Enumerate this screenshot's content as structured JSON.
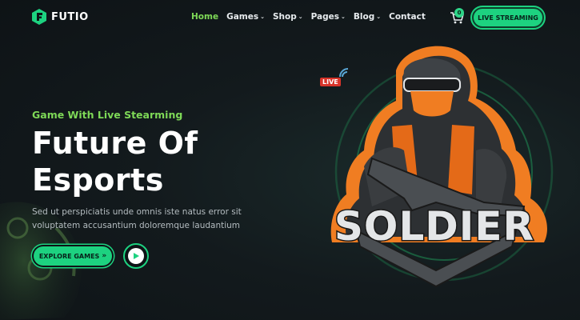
{
  "header": {
    "logo_text": "FUTIO",
    "nav": [
      {
        "label": "Home",
        "active": true,
        "dropdown": false
      },
      {
        "label": "Games",
        "active": false,
        "dropdown": true
      },
      {
        "label": "Shop",
        "active": false,
        "dropdown": true
      },
      {
        "label": "Pages",
        "active": false,
        "dropdown": true
      },
      {
        "label": "Blog",
        "active": false,
        "dropdown": true
      },
      {
        "label": "Contact",
        "active": false,
        "dropdown": false
      }
    ],
    "cart_count": "0",
    "live_button": "LIVE STREAMING"
  },
  "hero": {
    "subtitle": "Game With Live Stearming",
    "title_line1": "Future Of",
    "title_line2": "Esports",
    "description": "Sed ut perspiciatis unde omnis iste natus error sit voluptatem accusantium doloremque laudantium",
    "explore_button": "EXPLORE GAMES",
    "explore_icon": "double-chevron-right-icon",
    "play_icon": "play-icon"
  },
  "mascot": {
    "live_tag": "LIVE",
    "logo_text": "SOLDIER"
  },
  "colors": {
    "accent": "#1dd280",
    "accent_green_text": "#7ed957",
    "background": "#131a1d",
    "mascot_orange": "#f07d22",
    "live_red": "#d8342a"
  }
}
